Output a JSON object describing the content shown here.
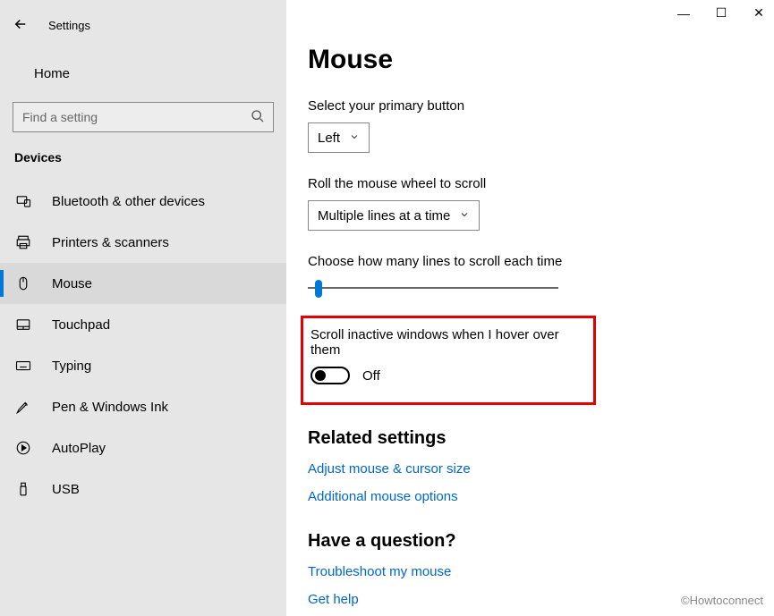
{
  "window": {
    "title": "Settings",
    "controls": {
      "min": "—",
      "max": "☐",
      "close": "✕"
    }
  },
  "sidebar": {
    "home": "Home",
    "search_placeholder": "Find a setting",
    "section": "Devices",
    "items": [
      {
        "icon": "bluetooth-icon",
        "label": "Bluetooth & other devices"
      },
      {
        "icon": "printer-icon",
        "label": "Printers & scanners"
      },
      {
        "icon": "mouse-icon",
        "label": "Mouse"
      },
      {
        "icon": "touchpad-icon",
        "label": "Touchpad"
      },
      {
        "icon": "keyboard-icon",
        "label": "Typing"
      },
      {
        "icon": "pen-icon",
        "label": "Pen & Windows Ink"
      },
      {
        "icon": "autoplay-icon",
        "label": "AutoPlay"
      },
      {
        "icon": "usb-icon",
        "label": "USB"
      }
    ],
    "active_index": 2
  },
  "main": {
    "title": "Mouse",
    "primary_button": {
      "label": "Select your primary button",
      "value": "Left"
    },
    "wheel_scroll": {
      "label": "Roll the mouse wheel to scroll",
      "value": "Multiple lines at a time"
    },
    "lines_label": "Choose how many lines to scroll each time",
    "hover": {
      "label": "Scroll inactive windows when I hover over them",
      "state": "Off"
    },
    "related": {
      "heading": "Related settings",
      "links": [
        "Adjust mouse & cursor size",
        "Additional mouse options"
      ]
    },
    "question": {
      "heading": "Have a question?",
      "links": [
        "Troubleshoot my mouse",
        "Get help"
      ]
    }
  },
  "watermark": "©Howtoconnect"
}
